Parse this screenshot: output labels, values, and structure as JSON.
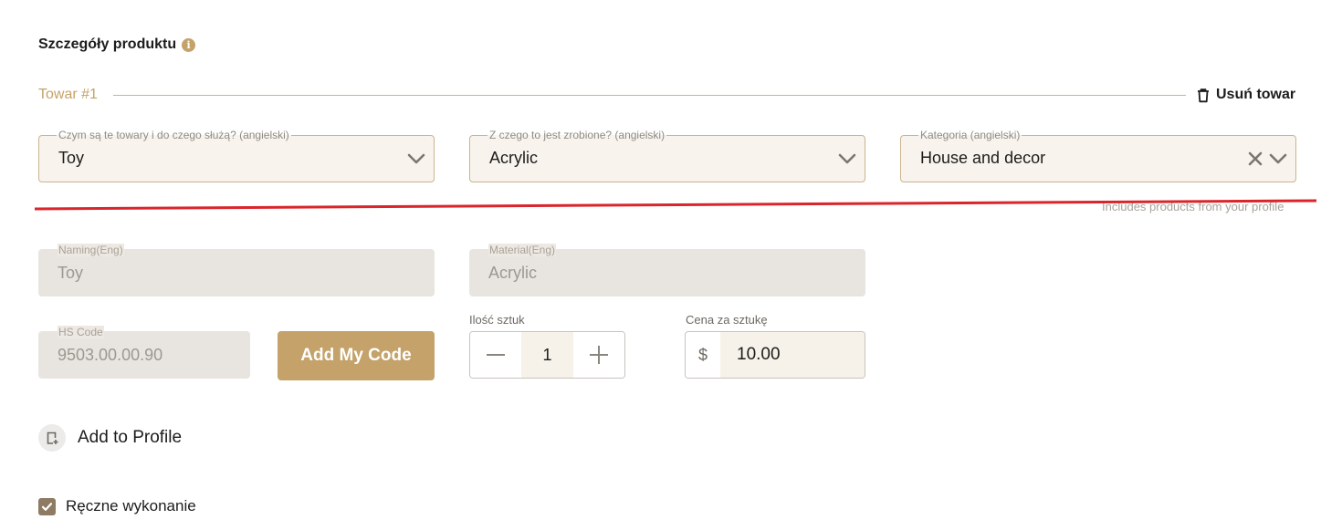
{
  "section": {
    "title": "Szczegóły produktu",
    "info_icon": "info-icon"
  },
  "item": {
    "title": "Towar #1",
    "remove_label": "Usuń towar",
    "remove_icon": "trash-icon"
  },
  "selects": {
    "purpose": {
      "label": "Czym są te towary i do czego służą? (angielski)",
      "value": "Toy"
    },
    "material": {
      "label": "Z czego to jest zrobione? (angielski)",
      "value": "Acrylic"
    },
    "category": {
      "label": "Kategoria (angielski)",
      "value": "House and decor",
      "hint": "Includes products from your profile"
    }
  },
  "fields": {
    "naming": {
      "label": "Naming(Eng)",
      "value": "Toy"
    },
    "material_eng": {
      "label": "Material(Eng)",
      "value": "Acrylic"
    },
    "hs_code": {
      "label": "HS Code",
      "value": "9503.00.00.90"
    }
  },
  "add_code_label": "Add My Code",
  "quantity": {
    "label": "Ilość sztuk",
    "value": "1"
  },
  "price": {
    "label": "Cena za sztukę",
    "currency": "$",
    "value": "10.00"
  },
  "profile": {
    "label": "Add to Profile",
    "icon": "add-to-profile-icon"
  },
  "handmade": {
    "label": "Ręczne wykonanie",
    "checked": true
  },
  "colors": {
    "accent": "#c4a26a",
    "annotation_line": "#d9252b",
    "checkbox": "#8e7b63"
  }
}
